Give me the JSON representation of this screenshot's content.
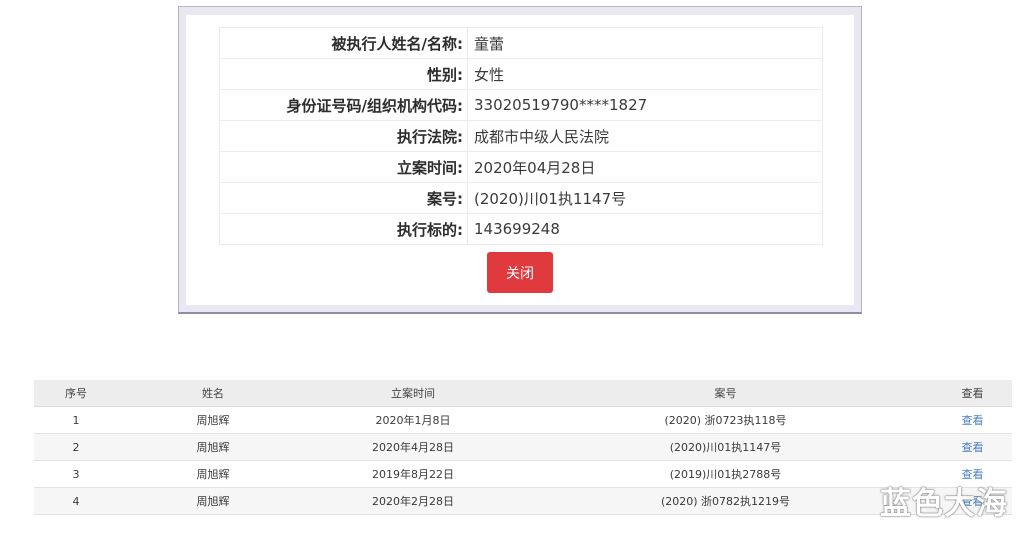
{
  "detail_modal": {
    "rows": [
      {
        "label": "被执行人姓名/名称:",
        "value": "童蕾"
      },
      {
        "label": "性别:",
        "value": "女性"
      },
      {
        "label": "身份证号码/组织机构代码:",
        "value": "33020519790****1827"
      },
      {
        "label": "执行法院:",
        "value": "成都市中级人民法院"
      },
      {
        "label": "立案时间:",
        "value": "2020年04月28日"
      },
      {
        "label": "案号:",
        "value": "(2020)川01执1147号"
      },
      {
        "label": "执行标的:",
        "value": "143699248"
      }
    ],
    "close_label": "关闭",
    "close_color": "#e0393e"
  },
  "results_table": {
    "headers": {
      "no": "序号",
      "name": "姓名",
      "date": "立案时间",
      "case": "案号",
      "view": "查看"
    },
    "rows": [
      {
        "no": "1",
        "name": "周旭辉",
        "date": "2020年1月8日",
        "case": "(2020) 浙0723执118号",
        "view": "查看"
      },
      {
        "no": "2",
        "name": "周旭辉",
        "date": "2020年4月28日",
        "case": "(2020)川01执1147号",
        "view": "查看"
      },
      {
        "no": "3",
        "name": "周旭辉",
        "date": "2019年8月22日",
        "case": "(2019)川01执2788号",
        "view": "查看"
      },
      {
        "no": "4",
        "name": "周旭辉",
        "date": "2020年2月28日",
        "case": "(2020) 浙0782执1219号",
        "view": "查看"
      }
    ],
    "link_color": "#4a7fc4"
  },
  "watermark": "蓝色大海"
}
